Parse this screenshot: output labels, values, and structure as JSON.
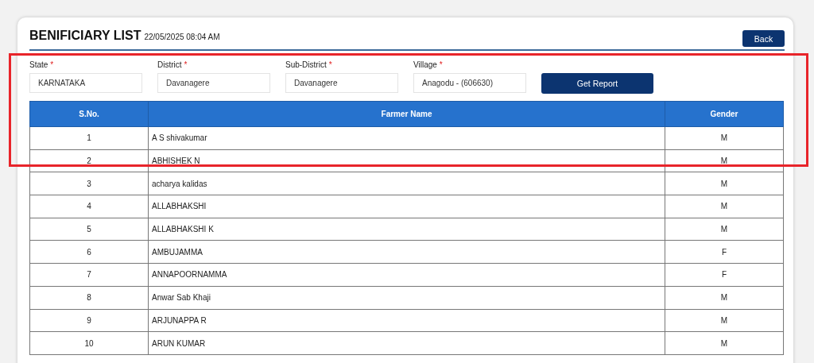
{
  "header": {
    "title": "BENIFICIARY LIST",
    "timestamp": "22/05/2025 08:04 AM",
    "back_button": "Back"
  },
  "filters": [
    {
      "label": "State",
      "required": true,
      "value": "KARNATAKA"
    },
    {
      "label": "District",
      "required": true,
      "value": "Davanagere"
    },
    {
      "label": "Sub-District",
      "required": true,
      "value": "Davanagere"
    },
    {
      "label": "Village",
      "required": true,
      "value": "Anagodu - (606630)"
    }
  ],
  "required_mark": "*",
  "report_button": "Get Report",
  "table": {
    "columns": [
      "S.No.",
      "Farmer Name",
      "Gender"
    ],
    "rows": [
      [
        "1",
        "A S shivakumar",
        "M"
      ],
      [
        "2",
        "ABHISHEK N",
        "M"
      ],
      [
        "3",
        "acharya kalidas",
        "M"
      ],
      [
        "4",
        "ALLABHAKSHI",
        "M"
      ],
      [
        "5",
        "ALLABHAKSHI K",
        "M"
      ],
      [
        "6",
        "AMBUJAMMA",
        "F"
      ],
      [
        "7",
        "ANNAPOORNAMMA",
        "F"
      ],
      [
        "8",
        "Anwar Sab Khaji",
        "M"
      ],
      [
        "9",
        "ARJUNAPPA R",
        "M"
      ],
      [
        "10",
        "ARUN KUMAR",
        "M"
      ]
    ]
  }
}
